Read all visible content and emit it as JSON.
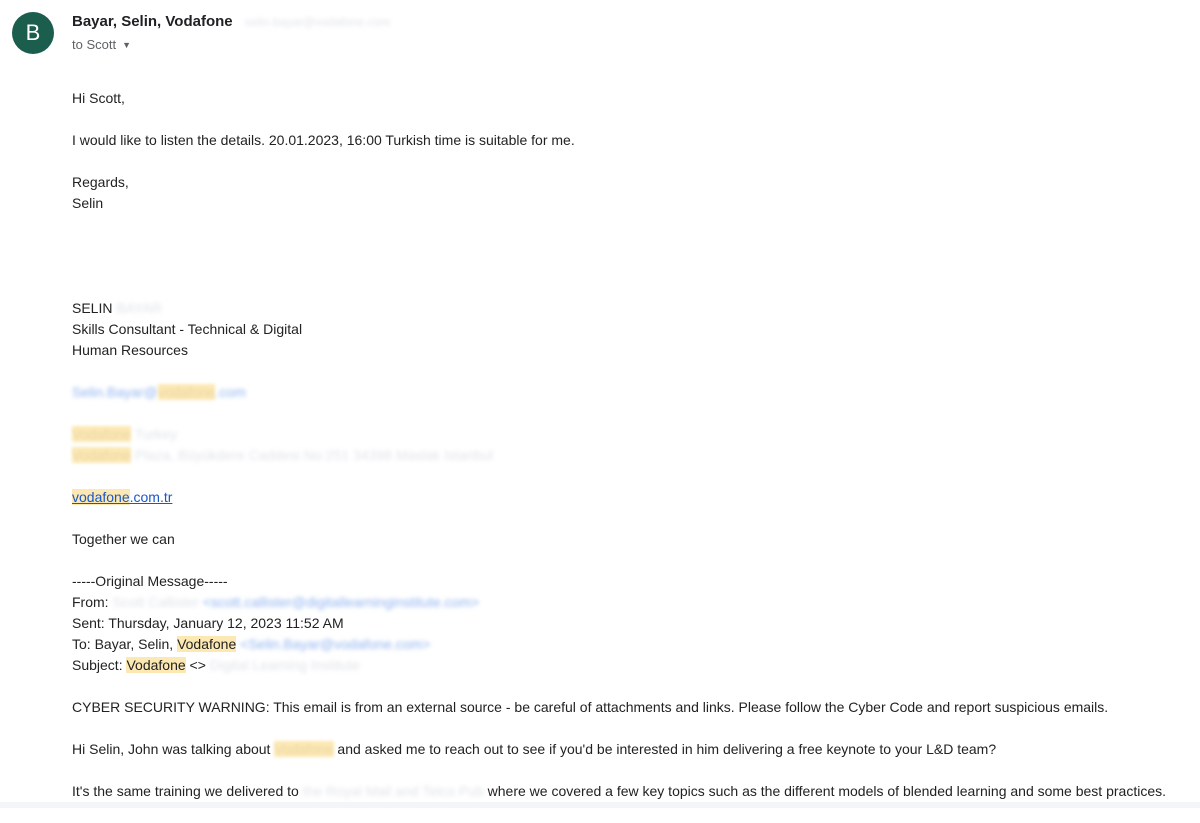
{
  "header": {
    "avatar_letter": "B",
    "sender_name": "Bayar, Selin, Vodafone",
    "sender_email": "selin.bayar@vodafone.com",
    "recipient": "to Scott",
    "avatar_color": "#1b5e4e"
  },
  "reply": {
    "greeting": "Hi Scott,",
    "message": "I would like to listen the details. 20.01.2023, 16:00 Turkish time is suitable for me.",
    "closing": "Regards,",
    "name": "Selin"
  },
  "signature": {
    "first_name": "SELIN",
    "surname": "BAYAR",
    "title": "Skills Consultant - Technical & Digital",
    "department": "Human Resources",
    "email_user": "Selin.Bayar@",
    "email_brand": "vodafone",
    "email_tld": ".com",
    "company_brand": "Vodafone",
    "company_suffix": " Turkey",
    "address_brand": "Vodafone",
    "address_rest": " Plaza, Büyükdere Caddesi No:251 34398 Maslak Istanbul",
    "web_brand": "vodafone",
    "web_tld": ".com.tr",
    "slogan": "Together we can"
  },
  "original": {
    "separator": "-----Original Message-----",
    "from_label": "From: ",
    "from_name": "Scott Callister",
    "from_email": "<scott.callister@digitallearninginstitute.com>",
    "sent_label": "Sent: ",
    "sent_value": "Thursday, January 12, 2023 11:52 AM",
    "to_label": "To: ",
    "to_name": "Bayar, Selin, ",
    "to_brand": "Vodafone",
    "to_email": "<Selin.Bayar@vodafone.com>",
    "subject_label": "Subject: ",
    "subject_brand": "Vodafone",
    "subject_sep": " <> ",
    "subject_rest": "Digital Learning Institute",
    "warning": "CYBER SECURITY WARNING: This email is from an external source - be careful of attachments and links. Please follow the Cyber Code and report suspicious emails.",
    "p1_start": "Hi Selin, John was talking about ",
    "p1_brand": "Vodafone",
    "p1_end": " and asked me to reach out to see if you'd be interested in him delivering a free keynote to your L&D team?",
    "p2_start": "It's the same training we delivered to ",
    "p2_blur": "the Royal Mail and Telco Pub",
    "p2_end": " where we covered a few key topics such as the different models of blended learning and some best practices."
  },
  "colors": {
    "highlight": "#fce8b2",
    "link": "#1a57c7"
  }
}
